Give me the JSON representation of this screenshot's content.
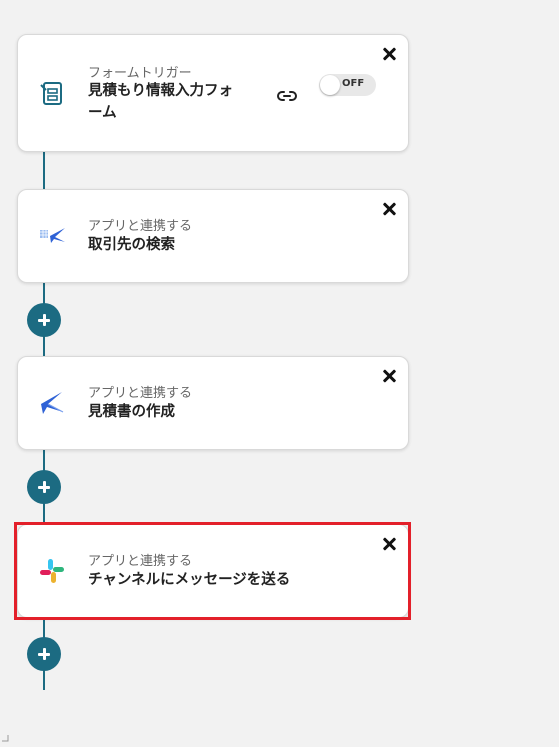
{
  "steps": [
    {
      "category": "フォームトリガー",
      "title_line1": "見積もり情報入力フォ",
      "title_line2": "ーム",
      "icon": "form-icon"
    },
    {
      "category": "アプリと連携する",
      "title": "取引先の検索",
      "icon": "invoice-app-icon"
    },
    {
      "category": "アプリと連携する",
      "title": "見積書の作成",
      "icon": "swallow-app-icon"
    },
    {
      "category": "アプリと連携する",
      "title": "チャンネルにメッセージを送る",
      "icon": "slack-icon"
    }
  ],
  "toggle": {
    "label": "OFF"
  },
  "colors": {
    "accent": "#1c6b82",
    "highlight": "#e3202a"
  }
}
